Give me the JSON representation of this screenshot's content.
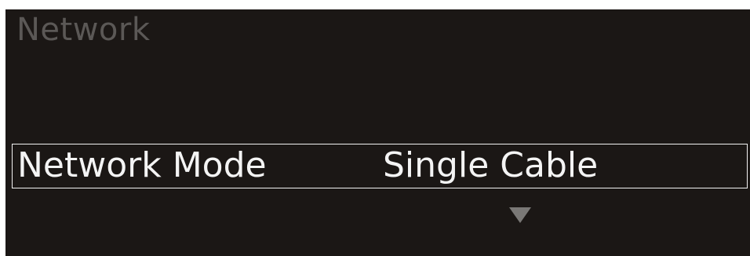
{
  "header": {
    "title": "Network"
  },
  "menu": {
    "selected_row": {
      "label": "Network Mode",
      "value": "Single Cable"
    },
    "scroll_indicator": "chevron-down-icon"
  },
  "colors": {
    "background": "#1b1715",
    "title_text": "#5b5856",
    "text": "#f4f4f4",
    "selection_border": "#f2f2f2",
    "indicator": "#7a7876"
  }
}
